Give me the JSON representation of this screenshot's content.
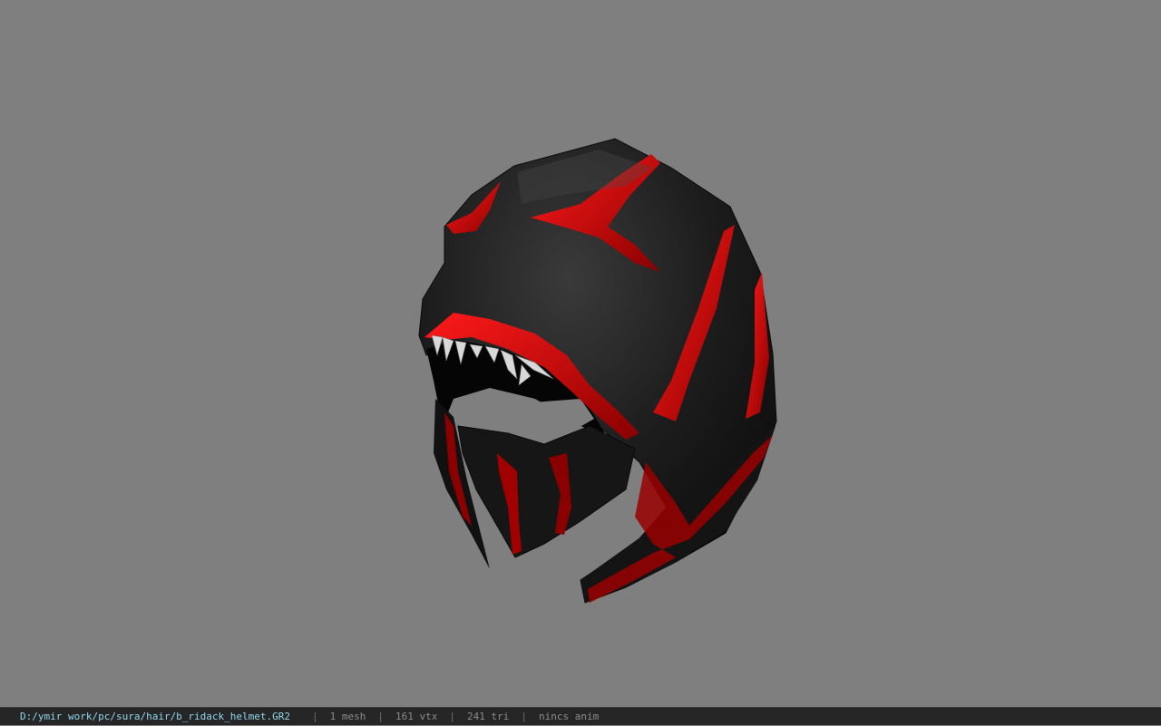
{
  "viewport": {
    "background_color": "#7f7f7f",
    "model": {
      "icon": "helmet-model",
      "base_color": "#1a1a1a",
      "accent_color": "#c4090c",
      "teeth_color": "#d8d8d8"
    }
  },
  "status": {
    "path": "D:/ymir work/pc/sura/hair/b_ridack_helmet.GR2",
    "separator": "|",
    "mesh": "1 mesh",
    "vertices": "161 vtx",
    "triangles": "241 tri",
    "animation": "nincs anim",
    "path_color": "#8fd6ec",
    "text_color": "#8c8c8c"
  }
}
